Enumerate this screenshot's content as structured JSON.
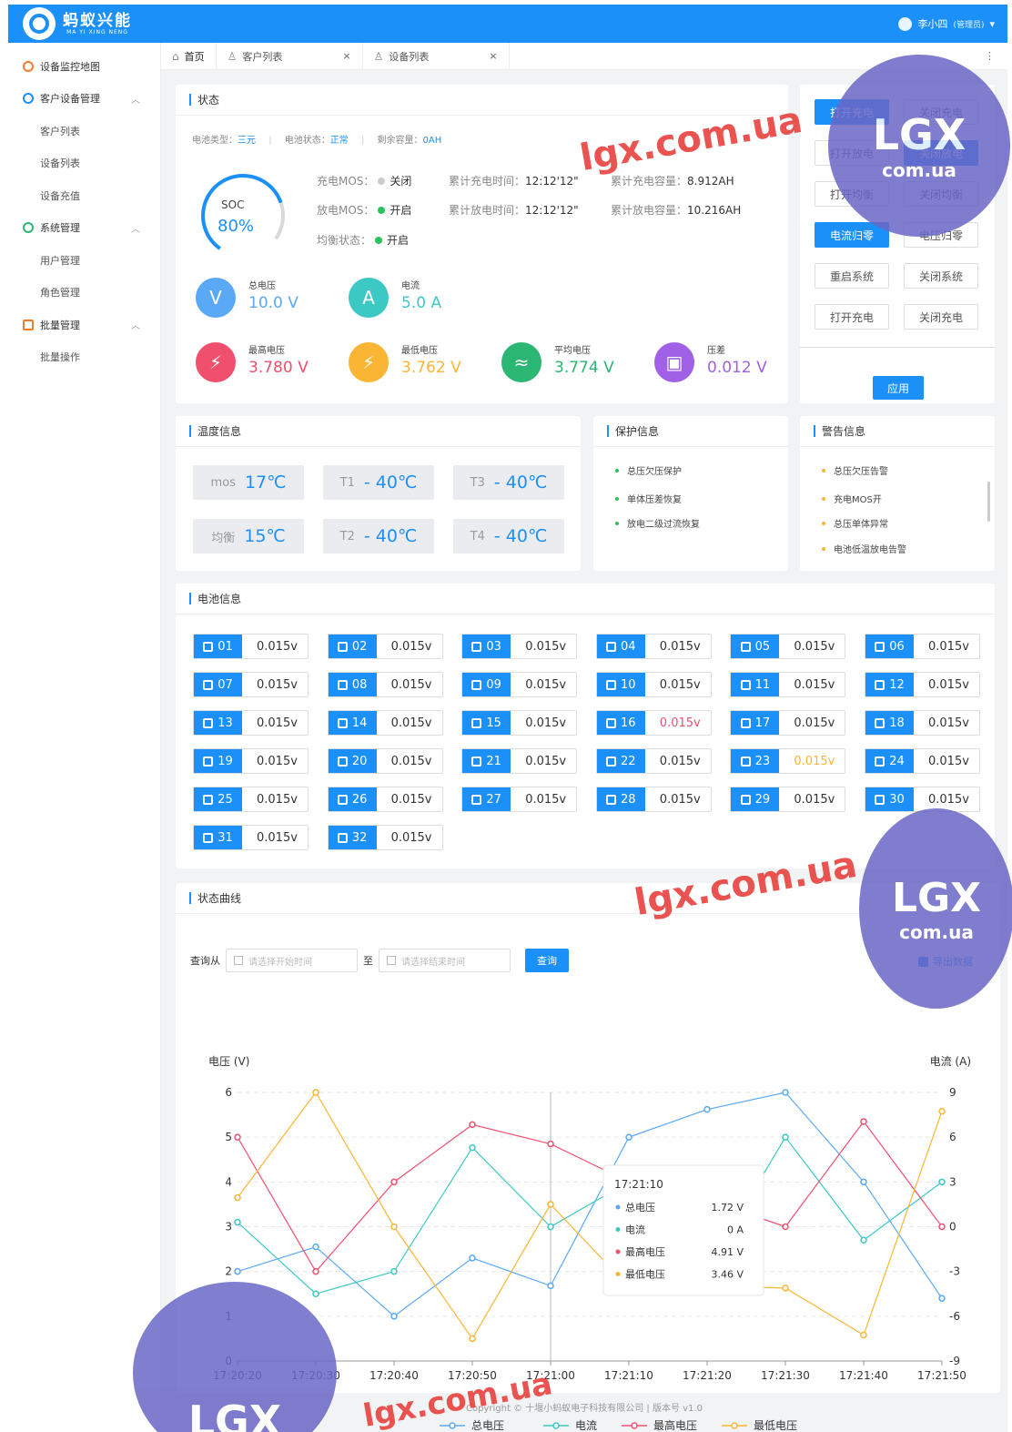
{
  "header": {
    "brand_cn": "蚂蚁兴能",
    "brand_en": "MA YI XING NENG",
    "user_name": "李小四",
    "user_role": "(管理员)",
    "user_caret": "▾"
  },
  "sidebar": {
    "items": [
      {
        "label": "设备监控地图",
        "type": "item",
        "icon": "map-pin-icon"
      },
      {
        "label": "客户设备管理",
        "type": "group",
        "icon": "users-icon",
        "arrow": "︿"
      },
      {
        "label": "客户列表",
        "type": "sub"
      },
      {
        "label": "设备列表",
        "type": "sub"
      },
      {
        "label": "设备充值",
        "type": "sub"
      },
      {
        "label": "系统管理",
        "type": "group",
        "icon": "gear-icon",
        "arrow": "︿"
      },
      {
        "label": "用户管理",
        "type": "sub"
      },
      {
        "label": "角色管理",
        "type": "sub"
      },
      {
        "label": "批量管理",
        "type": "group",
        "icon": "batch-icon",
        "arrow": "︿"
      },
      {
        "label": "批量操作",
        "type": "sub"
      }
    ]
  },
  "tabs": [
    {
      "label": "首页",
      "icon": "⌂",
      "closable": false
    },
    {
      "label": "客户列表",
      "icon": "♙",
      "closable": true
    },
    {
      "label": "设备列表",
      "icon": "♙",
      "closable": true
    }
  ],
  "tab_close": "×",
  "tab_more": "⋮",
  "status": {
    "title": "状态",
    "battery_type_label": "电池类型：",
    "battery_type": "三元",
    "battery_state_label": "电池状态：",
    "battery_state": "正常",
    "remaining_label": "剩余容量：",
    "remaining": "0AH",
    "sep": "|",
    "soc_label": "SOC",
    "soc_value": "80%",
    "soc_fraction": 0.8,
    "charge_mos_label": "充电MOS：",
    "charge_mos": "关闭",
    "discharge_mos_label": "放电MOS：",
    "discharge_mos": "开启",
    "balance_label": "均衡状态：",
    "balance": "开启",
    "charge_time_label": "累计充电时间：",
    "charge_time": "12:12'12\"",
    "discharge_time_label": "累计放电时间：",
    "discharge_time": "12:12'12\"",
    "charge_cap_label": "累计充电容量：",
    "charge_cap": "8.912AH",
    "discharge_cap_label": "累计放电容量：",
    "discharge_cap": "10.216AH",
    "metrics": [
      {
        "label": "总电压",
        "value": "10.0 V",
        "color": "#5aa9f6",
        "icon": "V"
      },
      {
        "label": "电流",
        "value": "5.0 A",
        "color": "#3cc9c4",
        "icon": "A"
      },
      {
        "label": "最高电压",
        "value": "3.780 V",
        "color": "#f0506e",
        "icon": "⚡"
      },
      {
        "label": "最低电压",
        "value": "3.762 V",
        "color": "#fbb534",
        "icon": "⚡"
      },
      {
        "label": "平均电压",
        "value": "3.774 V",
        "color": "#2bb673",
        "icon": "≈"
      },
      {
        "label": "压差",
        "value": "0.012 V",
        "color": "#a061e6",
        "icon": "▣"
      }
    ]
  },
  "controls": {
    "buttons": [
      {
        "label": "打开充电",
        "on": true
      },
      {
        "label": "关闭充电",
        "on": false
      },
      {
        "label": "打开放电",
        "on": false
      },
      {
        "label": "关闭放电",
        "on": true
      },
      {
        "label": "打开均衡",
        "on": false
      },
      {
        "label": "关闭均衡",
        "on": false
      },
      {
        "label": "电流归零",
        "on": true
      },
      {
        "label": "电压归零",
        "on": false
      },
      {
        "label": "重启系统",
        "on": false
      },
      {
        "label": "关闭系统",
        "on": false
      },
      {
        "label": "打开充电",
        "on": false
      },
      {
        "label": "关闭充电",
        "on": false
      }
    ],
    "apply_label": "应用"
  },
  "temperature": {
    "title": "温度信息",
    "items": [
      {
        "label": "mos",
        "value": "17℃"
      },
      {
        "label": "T1",
        "value": "- 40℃"
      },
      {
        "label": "T3",
        "value": "- 40℃"
      },
      {
        "label": "均衡",
        "value": "15℃"
      },
      {
        "label": "T2",
        "value": "- 40℃"
      },
      {
        "label": "T4",
        "value": "- 40℃"
      }
    ]
  },
  "protection": {
    "title": "保护信息",
    "items": [
      "总压欠压保护",
      "单体压差恢复",
      "放电二级过流恢复"
    ]
  },
  "warning": {
    "title": "警告信息",
    "items": [
      "总压欠压告警",
      "充电MOS开",
      "总压单体异常",
      "电池低温放电告警"
    ]
  },
  "battery": {
    "title": "电池信息",
    "cells": [
      {
        "id": "01",
        "v": "0.015v",
        "s": ""
      },
      {
        "id": "02",
        "v": "0.015v",
        "s": ""
      },
      {
        "id": "03",
        "v": "0.015v",
        "s": ""
      },
      {
        "id": "04",
        "v": "0.015v",
        "s": ""
      },
      {
        "id": "05",
        "v": "0.015v",
        "s": ""
      },
      {
        "id": "06",
        "v": "0.015v",
        "s": ""
      },
      {
        "id": "07",
        "v": "0.015v",
        "s": ""
      },
      {
        "id": "08",
        "v": "0.015v",
        "s": ""
      },
      {
        "id": "09",
        "v": "0.015v",
        "s": ""
      },
      {
        "id": "10",
        "v": "0.015v",
        "s": ""
      },
      {
        "id": "11",
        "v": "0.015v",
        "s": ""
      },
      {
        "id": "12",
        "v": "0.015v",
        "s": ""
      },
      {
        "id": "13",
        "v": "0.015v",
        "s": ""
      },
      {
        "id": "14",
        "v": "0.015v",
        "s": ""
      },
      {
        "id": "15",
        "v": "0.015v",
        "s": ""
      },
      {
        "id": "16",
        "v": "0.015v",
        "s": "red"
      },
      {
        "id": "17",
        "v": "0.015v",
        "s": ""
      },
      {
        "id": "18",
        "v": "0.015v",
        "s": ""
      },
      {
        "id": "19",
        "v": "0.015v",
        "s": ""
      },
      {
        "id": "20",
        "v": "0.015v",
        "s": ""
      },
      {
        "id": "21",
        "v": "0.015v",
        "s": ""
      },
      {
        "id": "22",
        "v": "0.015v",
        "s": ""
      },
      {
        "id": "23",
        "v": "0.015v",
        "s": "orange"
      },
      {
        "id": "24",
        "v": "0.015v",
        "s": ""
      },
      {
        "id": "25",
        "v": "0.015v",
        "s": ""
      },
      {
        "id": "26",
        "v": "0.015v",
        "s": ""
      },
      {
        "id": "27",
        "v": "0.015v",
        "s": ""
      },
      {
        "id": "28",
        "v": "0.015v",
        "s": ""
      },
      {
        "id": "29",
        "v": "0.015v",
        "s": ""
      },
      {
        "id": "30",
        "v": "0.015v",
        "s": ""
      },
      {
        "id": "31",
        "v": "0.015v",
        "s": ""
      },
      {
        "id": "32",
        "v": "0.015v",
        "s": ""
      }
    ]
  },
  "curve": {
    "title": "状态曲线",
    "query_from": "查询从",
    "start_placeholder": "请选择开始时间",
    "to": "至",
    "end_placeholder": "请选择结束时间",
    "query_btn": "查询",
    "export": "导出数据"
  },
  "tooltip": {
    "time": "17:21:10",
    "rows": [
      {
        "name": "总电压",
        "value": "1.72 V",
        "color": "#5aa9f6"
      },
      {
        "name": "电流",
        "value": "0 A",
        "color": "#3cc9c4"
      },
      {
        "name": "最高电压",
        "value": "4.91 V",
        "color": "#f0506e"
      },
      {
        "name": "最低电压",
        "value": "3.46 V",
        "color": "#fbb534"
      }
    ]
  },
  "chart_data": {
    "type": "line",
    "ylabel": "电压 (V)",
    "y2label": "电流 (A)",
    "ylim": [
      0,
      6
    ],
    "y2lim": [
      -9,
      9
    ],
    "yticks": [
      "0",
      "1",
      "2",
      "3",
      "4",
      "5",
      "6"
    ],
    "y2ticks": [
      "-9",
      "-6",
      "-3",
      "0",
      "3",
      "6",
      "9"
    ],
    "categories": [
      "17:20:20",
      "17:20:30",
      "17:20:40",
      "17:20:50",
      "17:21:00",
      "17:21:10",
      "17:21:20",
      "17:21:30",
      "17:21:40",
      "17:21:50"
    ],
    "series": [
      {
        "name": "总电压",
        "axis": "left",
        "color": "#5aa9f6",
        "values": [
          2.0,
          2.55,
          1.0,
          2.3,
          1.68,
          5.0,
          5.62,
          6.0,
          4.0,
          1.4
        ]
      },
      {
        "name": "电流",
        "axis": "right",
        "color": "#3cc9c4",
        "values": [
          0.3,
          -4.5,
          -3.0,
          5.3,
          0.0,
          3.0,
          -2.8,
          6.0,
          -0.9,
          3.0
        ]
      },
      {
        "name": "最高电压",
        "axis": "left",
        "color": "#f0506e",
        "values": [
          5.0,
          2.0,
          4.0,
          5.28,
          4.85,
          4.0,
          3.6,
          3.0,
          5.35,
          3.0
        ]
      },
      {
        "name": "最低电压",
        "axis": "left",
        "color": "#fbb534",
        "values": [
          3.65,
          6.0,
          3.0,
          0.5,
          3.5,
          1.65,
          1.68,
          1.63,
          0.58,
          5.58
        ]
      }
    ],
    "legend": "bottom-center",
    "grid": true
  },
  "footer": "Copyright © 十堰小蚂蚁电子科技有限公司 | 版本号 v1.0",
  "watermark": {
    "text": "lgx.com.ua",
    "badge": "LGX",
    "badge_sub": "com.ua"
  }
}
